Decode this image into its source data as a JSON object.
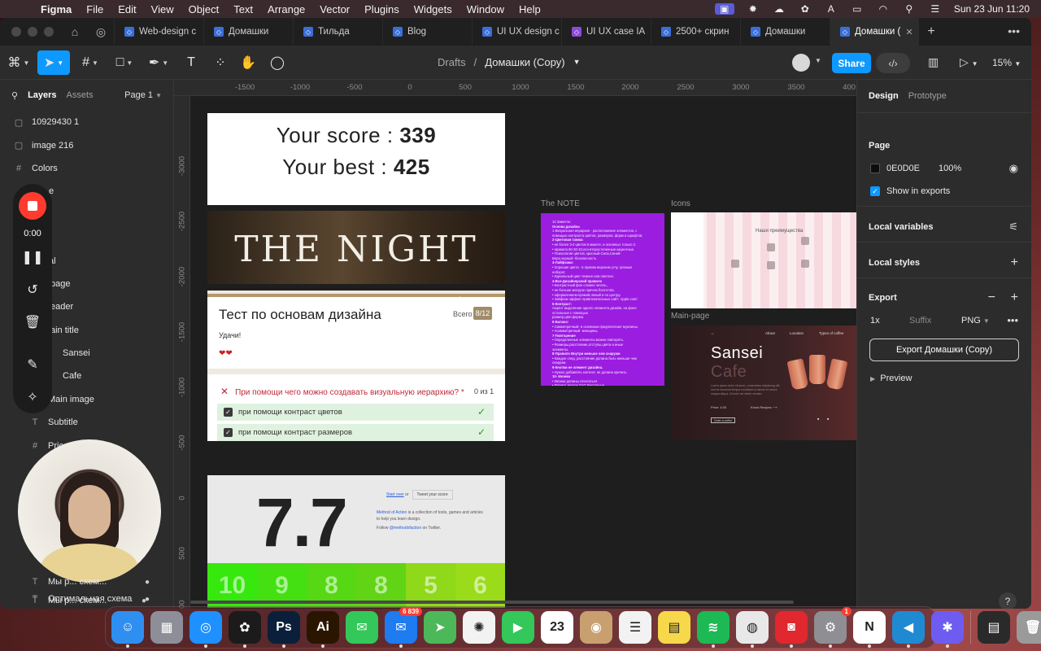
{
  "menubar": {
    "app": "Figma",
    "items": [
      "File",
      "Edit",
      "View",
      "Object",
      "Text",
      "Arrange",
      "Vector",
      "Plugins",
      "Widgets",
      "Window",
      "Help"
    ],
    "clock": "Sun 23 Jun  11:20",
    "status_icons": [
      "screen-record-icon",
      "gear-icon",
      "creative-cloud-icon",
      "figma-icon",
      "keyboard-input-icon",
      "battery-icon",
      "wifi-icon",
      "search-icon",
      "control-center-icon"
    ]
  },
  "tabs": [
    {
      "label": "Web-design c",
      "color": "#3b6fd8"
    },
    {
      "label": "Домашки",
      "color": "#3b6fd8"
    },
    {
      "label": "Тильда",
      "color": "#3b6fd8"
    },
    {
      "label": "Blog",
      "color": "#3b6fd8"
    },
    {
      "label": "UI UX design c",
      "color": "#3b6fd8"
    },
    {
      "label": "UI UX case IA",
      "color": "#8b4ad8"
    },
    {
      "label": "2500+ скрин",
      "color": "#3b6fd8"
    },
    {
      "label": "Домашки",
      "color": "#3b6fd8"
    },
    {
      "label": "Домашки (",
      "color": "#3b6fd8",
      "active": true
    }
  ],
  "toolbar": {
    "breadcrumb_root": "Drafts",
    "breadcrumb_sep": "/",
    "file_name": "Домашки (Copy)",
    "share_label": "Share",
    "zoom": "15%"
  },
  "layers_panel": {
    "tab_layers": "Layers",
    "tab_assets": "Assets",
    "page": "Page 1",
    "items": [
      {
        "icon": "▢",
        "label": "10929430 1"
      },
      {
        "icon": "▢",
        "label": "image 216"
      },
      {
        "icon": "#",
        "label": "Colors"
      },
      {
        "icon": "",
        "label": "e"
      },
      {
        "icon": "",
        "label": ""
      },
      {
        "icon": "",
        "label": ""
      },
      {
        "icon": "",
        "label": "al"
      },
      {
        "icon": "",
        "label": "page"
      },
      {
        "icon": "",
        "label": "eader"
      },
      {
        "icon": "",
        "label": "ain title"
      },
      {
        "icon": "T",
        "label": "Sansei"
      },
      {
        "icon": "T",
        "label": "Cafe"
      },
      {
        "icon": "▢",
        "label": "Main image"
      },
      {
        "icon": "T",
        "label": "Subtitle"
      },
      {
        "icon": "#",
        "label": "Price"
      }
    ],
    "bottom_items": [
      {
        "icon": "T",
        "label": "Мы р... схем..."
      },
      {
        "icon": "T",
        "label": "Оптимальная схема"
      }
    ]
  },
  "recorder": {
    "time": "0:00"
  },
  "rulers": {
    "top": [
      "-1500",
      "-1000",
      "-500",
      "0",
      "500",
      "1000",
      "1500",
      "2000",
      "2500",
      "3000",
      "3500",
      "400"
    ],
    "left": [
      "-3000",
      "-2500",
      "-2000",
      "-1500",
      "-1000",
      "-500",
      "0",
      "500",
      "1000"
    ]
  },
  "canvas": {
    "score": {
      "line1_label": "Your score : ",
      "line1_value": "339",
      "line2_label": "Your best : ",
      "line2_value": "425"
    },
    "night": {
      "title": "THE NIGHT"
    },
    "quiz": {
      "title": "Тест по основам дизайна",
      "total_label": "Всего",
      "total_value": "8/12",
      "luck": "Удачи!",
      "hearts": "❤❤",
      "question": "При помощи чего можно создавать визуальную иерархию? *",
      "question_count": "0 из 1",
      "options": [
        "при помощи контраст цветов",
        "при помощи контраст размеров"
      ]
    },
    "rating": {
      "score": "7.7",
      "start_over": "Start over",
      "or": "or",
      "tweet": "Tweet your score",
      "desc_link": "Method of Action",
      "desc_rest": " is a collection of tools, games and articles",
      "desc_line2": "to help you learn design.",
      "follow_prefix": "Follow ",
      "follow_link": "@methodofaction",
      "follow_suffix": " on Twitter.",
      "cells": [
        {
          "value": "10",
          "color": "#37e80e"
        },
        {
          "value": "9",
          "color": "#44e012"
        },
        {
          "value": "8",
          "color": "#56d814"
        },
        {
          "value": "8",
          "color": "#62d416"
        },
        {
          "value": "5",
          "color": "#8fd81a"
        },
        {
          "value": "6",
          "color": "#9adc1a"
        }
      ]
    },
    "note": {
      "label": "The NOTE",
      "lines": [
        {
          "t": "10 Заметок:",
          "h": false
        },
        {
          "t": "Основа дизайна",
          "h": true
        },
        {
          "t": "1-Визуальная иерархия - расположение элементов, с",
          "h": false
        },
        {
          "t": "помощью контраста цветов, размеров, форм и шрифтов.",
          "h": false
        },
        {
          "t": "2-Цветовая гамма:",
          "h": true
        },
        {
          "t": "• не более 3-4 цветов в макете, и основных только 2.",
          "h": false
        },
        {
          "t": "• правило 60-30-10,осн-второстепенные-акцентные.",
          "h": false
        },
        {
          "t": "• Психология цветов, красный-Сила,Синий-",
          "h": false
        },
        {
          "t": "  Вера,черный -безопасность",
          "h": false
        },
        {
          "t": "3-Лайфхаки:",
          "h": true
        },
        {
          "t": "• Хорошие цвета - в правом верхнем углу, грязные",
          "h": false
        },
        {
          "t": "  ноборот.",
          "h": false
        },
        {
          "t": "• Идеальный цвет темнее или светлее.",
          "h": false
        },
        {
          "t": "4-Все-Дизайнерский правило",
          "h": true
        },
        {
          "t": "• Контрастный фон сложно читать,",
          "h": false
        },
        {
          "t": "• не больше матрузе причем богатства.",
          "h": false
        },
        {
          "t": "• оформлением-прямой,левый и по центру.",
          "h": false
        },
        {
          "t": "• лайфхак-эффект привлекательных-сайт: Apple.com/",
          "h": false
        },
        {
          "t": "5-Контраст:",
          "h": true
        },
        {
          "t": "Акцент выделение одного элемента дизайн, на фоне",
          "h": false
        },
        {
          "t": "остальные с помощью",
          "h": false
        },
        {
          "t": "размер,цвет,форма.",
          "h": false
        },
        {
          "t": "6-Баланс:",
          "h": true
        },
        {
          "t": "• Симметричный- в основном предпочитают мужчины.",
          "h": false
        },
        {
          "t": "• Асимметричный -женщины.",
          "h": false
        },
        {
          "t": "7-Повторение",
          "h": true
        },
        {
          "t": "• Определенные элементы можно повторять.",
          "h": false
        },
        {
          "t": "• Размеры,расстояние,отступы,цвета и иные",
          "h": false
        },
        {
          "t": "  элементы.",
          "h": false
        },
        {
          "t": "8-Правило Внутри меньше чем снаружи",
          "h": true
        },
        {
          "t": "• Каждое след. расстояние должна быть меньше чем",
          "h": false
        },
        {
          "t": "  снаружи.",
          "h": false
        },
        {
          "t": "9-Кнопки не элемент дизайна.",
          "h": true
        },
        {
          "t": "• Нужно добавлять контент, не должно кричать.",
          "h": false
        },
        {
          "t": "10- Иконки",
          "h": true
        },
        {
          "t": "• Иконки должны сочетаться",
          "h": false
        },
        {
          "t": "• Формат иконок SVG Векторные",
          "h": false
        }
      ]
    },
    "icons_frame": {
      "label": "Icons",
      "heading": "Наши преимущества"
    },
    "main_page": {
      "label": "Main-page",
      "nav": [
        "About",
        "Location",
        "Types of coffee"
      ],
      "title1": "Sansei",
      "title2": "Cafe",
      "paragraph": "Lorem ipsum dolor sit amet, consectetur adipiscing elit, sed do eiusmod tempor incididunt ut labore et dolore magna aliqua. Ut enim ad minim veniam.",
      "price": "Price: 4.00",
      "recipes": "Know Recipes ⟶",
      "cta": "Order a coffee"
    }
  },
  "design_panel": {
    "tab_design": "Design",
    "tab_prototype": "Prototype",
    "page_title": "Page",
    "page_color": "0E0D0E",
    "page_opacity": "100%",
    "show_in_exports": "Show in exports",
    "local_variables": "Local variables",
    "local_styles": "Local styles",
    "export_title": "Export",
    "export_scale": "1x",
    "export_suffix_placeholder": "Suffix",
    "export_format": "PNG",
    "export_button": "Export Домашки (Copy)",
    "preview": "Preview",
    "help": "?"
  },
  "dock": {
    "apps": [
      {
        "name": "finder",
        "glyph": "☺",
        "color": "#2f8ff0",
        "running": true
      },
      {
        "name": "launchpad",
        "glyph": "▦",
        "color": "#8e8e99",
        "running": false
      },
      {
        "name": "safari",
        "glyph": "◎",
        "color": "#1e90ff",
        "running": true
      },
      {
        "name": "figma",
        "glyph": "✿",
        "color": "#1b1b1b",
        "running": true
      },
      {
        "name": "photoshop",
        "glyph": "Ps",
        "color": "#0b1f3a",
        "running": true
      },
      {
        "name": "illustrator",
        "glyph": "Ai",
        "color": "#2a1600",
        "running": true
      },
      {
        "name": "messages",
        "glyph": "✉",
        "color": "#34c759",
        "running": false
      },
      {
        "name": "mail",
        "glyph": "✉",
        "color": "#1e7bf0",
        "running": true,
        "badge": "6 839"
      },
      {
        "name": "maps",
        "glyph": "➤",
        "color": "#4cb85a",
        "running": false
      },
      {
        "name": "photos",
        "glyph": "✺",
        "color": "#f2f2f2",
        "running": false
      },
      {
        "name": "facetime",
        "glyph": "▶",
        "color": "#34c759",
        "running": false
      },
      {
        "name": "calendar",
        "glyph": "23",
        "color": "#ffffff",
        "running": false
      },
      {
        "name": "contacts",
        "glyph": "◉",
        "color": "#c8a070",
        "running": false
      },
      {
        "name": "reminders",
        "glyph": "☰",
        "color": "#f2f2f2",
        "running": false
      },
      {
        "name": "notes",
        "glyph": "▤",
        "color": "#f7d84a",
        "running": false
      },
      {
        "name": "spotify",
        "glyph": "≋",
        "color": "#1db954",
        "running": true
      },
      {
        "name": "chrome",
        "glyph": "◍",
        "color": "#e8e8e8",
        "running": true
      },
      {
        "name": "screen-recorder",
        "glyph": "◙",
        "color": "#e0282e",
        "running": true
      },
      {
        "name": "system-settings",
        "glyph": "⚙",
        "color": "#8e8e93",
        "running": true,
        "badge": "1"
      },
      {
        "name": "notion",
        "glyph": "N",
        "color": "#ffffff",
        "running": true
      },
      {
        "name": "vscode",
        "glyph": "◀",
        "color": "#1f8ad2",
        "running": true
      },
      {
        "name": "chatgpt",
        "glyph": "✱",
        "color": "#6e5cf0",
        "running": true
      }
    ],
    "trailing": [
      {
        "name": "recent-item",
        "glyph": "▤",
        "color": "#2a2a2a"
      },
      {
        "name": "trash",
        "glyph": "🗑",
        "color": "#9a9a9a"
      }
    ]
  }
}
